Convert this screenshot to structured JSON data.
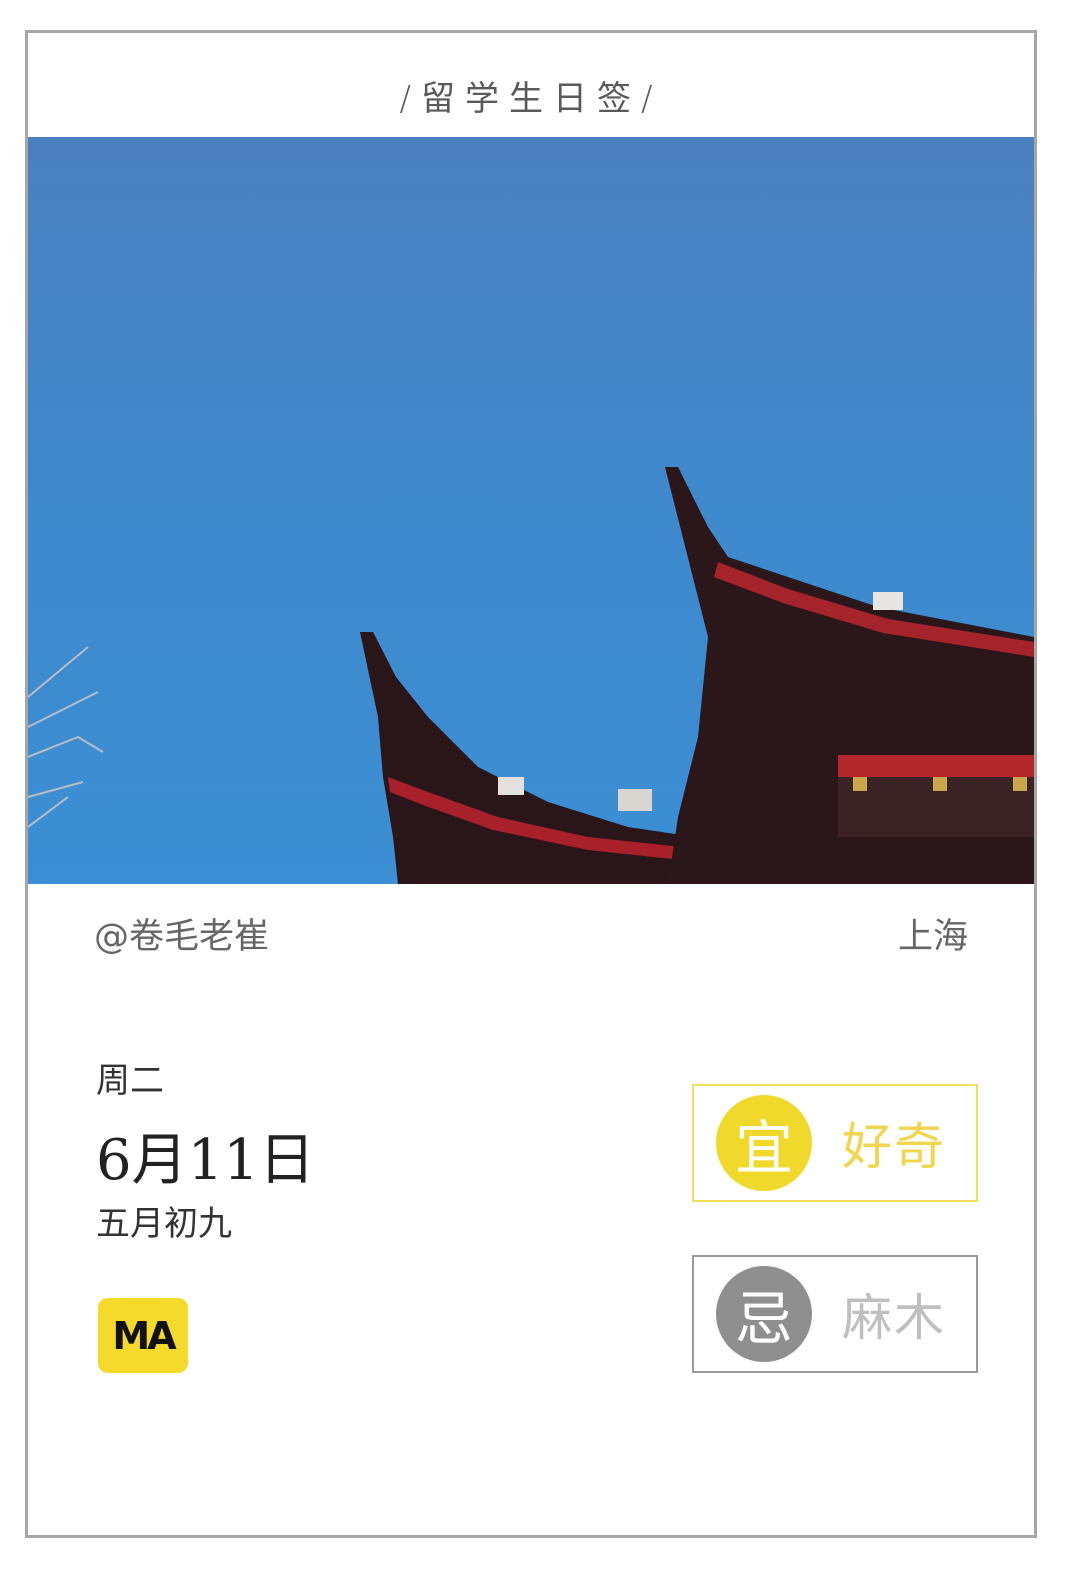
{
  "header": {
    "title": "/留学生日签/"
  },
  "photo": {
    "alt": ""
  },
  "footer": {
    "author": "@卷毛老崔",
    "location": "上海",
    "weekday": "周二",
    "date": "6月11日",
    "lunar_date": "五月初九",
    "logo_text": "MA"
  },
  "fortune": {
    "yi": {
      "char": "宜",
      "text": "好奇"
    },
    "ji": {
      "char": "忌",
      "text": "麻木"
    }
  },
  "colors": {
    "accent_yellow": "#f0d92a",
    "grey": "#8f8f8f",
    "sky": "#3c86c6"
  }
}
